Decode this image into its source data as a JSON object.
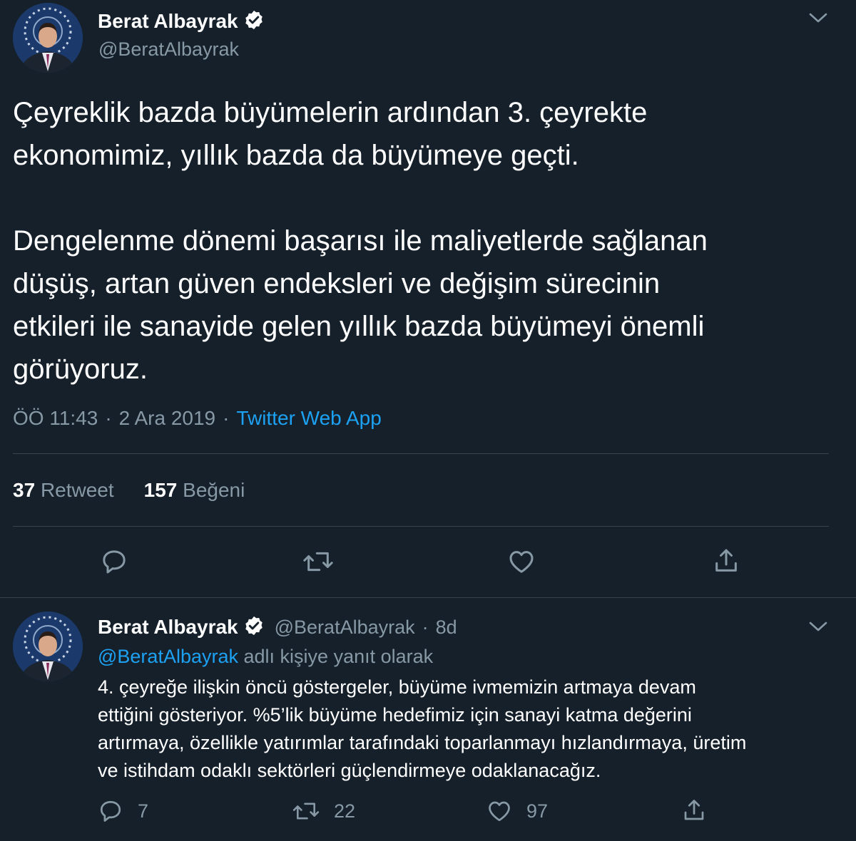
{
  "main_tweet": {
    "author": {
      "name": "Berat Albayrak",
      "handle": "@BeratAlbayrak"
    },
    "text": [
      "Çeyreklik bazda büyümelerin ardından 3. çeyrekte",
      "ekonomimiz, yıllık bazda da büyümeye geçti.",
      "",
      "Dengelenme dönemi başarısı ile maliyetlerde sağlanan",
      "düşüş, artan güven endeksleri ve değişim sürecinin",
      "etkileri ile sanayide gelen yıllık bazda büyümeyi önemli",
      "görüyoruz."
    ],
    "meta": {
      "time": "ÖÖ 11:43",
      "sep1": "·",
      "date": "2 Ara 2019",
      "sep2": "·",
      "source": "Twitter Web App"
    },
    "stats": {
      "retweets": "37",
      "retweets_label": "Retweet",
      "likes": "157",
      "likes_label": "Beğeni"
    },
    "icons": [
      "reply-icon",
      "retweet-icon",
      "like-icon",
      "share-icon"
    ]
  },
  "reply_tweet": {
    "author": {
      "name": "Berat Albayrak",
      "handle": "@BeratAlbayrak",
      "sep": "·",
      "age": "8d"
    },
    "replying_to": {
      "handle": "@BeratAlbayrak",
      "suffix": "adlı kişiye yanıt olarak"
    },
    "text": [
      "4. çeyreğe ilişkin öncü göstergeler, büyüme ivmemizin artmaya devam",
      "ettiğini gösteriyor. %5’lik büyüme hedefimiz için sanayi katma değerini",
      "artırmaya, özellikle yatırımlar tarafındaki toparlanmayı hızlandırmaya, üretim",
      "ve istihdam odaklı sektörleri güçlendirmeye odaklanacağız."
    ],
    "actions": {
      "replies": "7",
      "retweets": "22",
      "likes": "97"
    }
  },
  "colors": {
    "background": "#15202b",
    "text": "#ffffff",
    "muted": "#8899a6",
    "link": "#1da1f2",
    "divider": "#38444d"
  }
}
